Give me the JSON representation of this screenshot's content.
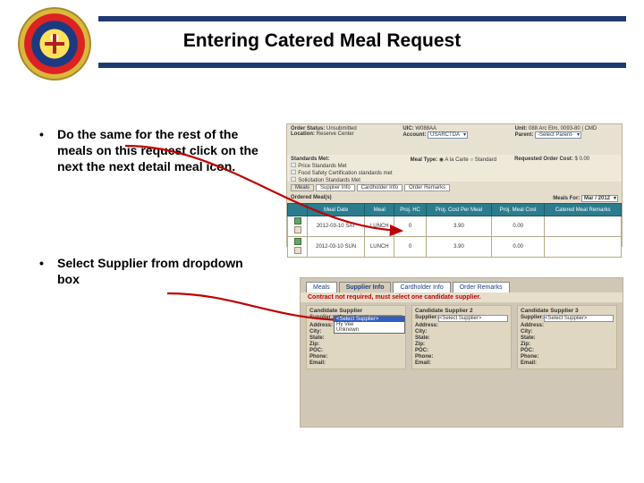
{
  "header": {
    "title": "Entering Catered Meal Request"
  },
  "bullets": [
    "Do the same for the rest of the meals on this request click on the next the next detail meal icon.",
    "Select Supplier from dropdown box"
  ],
  "panel1": {
    "order_status_label": "Order Status:",
    "order_status_value": "Unsubmitted",
    "location_label": "Location:",
    "location_value": "Reserve Center",
    "uic_label": "UIC:",
    "uic_value": "W088AA",
    "account_label": "Account:",
    "account_value": "USARCTDA",
    "unit_label": "Unit:",
    "unit_value": "088 Arc Elm, 0093-80 | CMD",
    "parent_label": "Parent:",
    "parent_select": "-Select Parent-",
    "standards_label": "Standards Met:",
    "standards": [
      "Price Standards Met",
      "Food Safety Certification standards met",
      "Solicitation Standards Met"
    ],
    "mealtype_label": "Meal Type:",
    "requested_order_label": "Requested Order Cost:",
    "requested_order_value": "$ 0.00",
    "tabs": [
      "Supplier Info",
      "Cardholder Info",
      "Order Remarks"
    ],
    "tab_meal": "Meals",
    "ordered_label": "Ordered Meal(s)",
    "meals_for_label": "Meals For:",
    "meals_for_value": "Mar / 2012",
    "grid": {
      "headers": [
        "",
        "Meal Date",
        "Meal",
        "Proj. HC",
        "Proj. Cost Per Meal",
        "Proj. Meal Cost",
        "Catered Meal Remarks"
      ],
      "rows": [
        [
          "2012-03-10 SAT",
          "LUNCH",
          "0",
          "3.90",
          "0.00",
          ""
        ],
        [
          "2012-03-10 SUN",
          "LUNCH",
          "0",
          "3.90",
          "0.00",
          ""
        ]
      ]
    }
  },
  "panel2": {
    "tabs": [
      "Meals",
      "Supplier Info",
      "Cardholder Info",
      "Order Remarks"
    ],
    "red_note": "Contract not required, must select one candidate supplier.",
    "candidate_labels": [
      "Candidate Supplier",
      "Candidate Supplier 2",
      "Candidate Supplier 3"
    ],
    "fields": [
      "Supplier:",
      "Address:",
      "City:",
      "State:",
      "Zip:",
      "POC:",
      "Phone:",
      "Email:"
    ],
    "select_placeholder": "<Select Supplier>",
    "dropdown_options": [
      "<Select Supplier>",
      "Hy Vee",
      "Unknown"
    ]
  }
}
